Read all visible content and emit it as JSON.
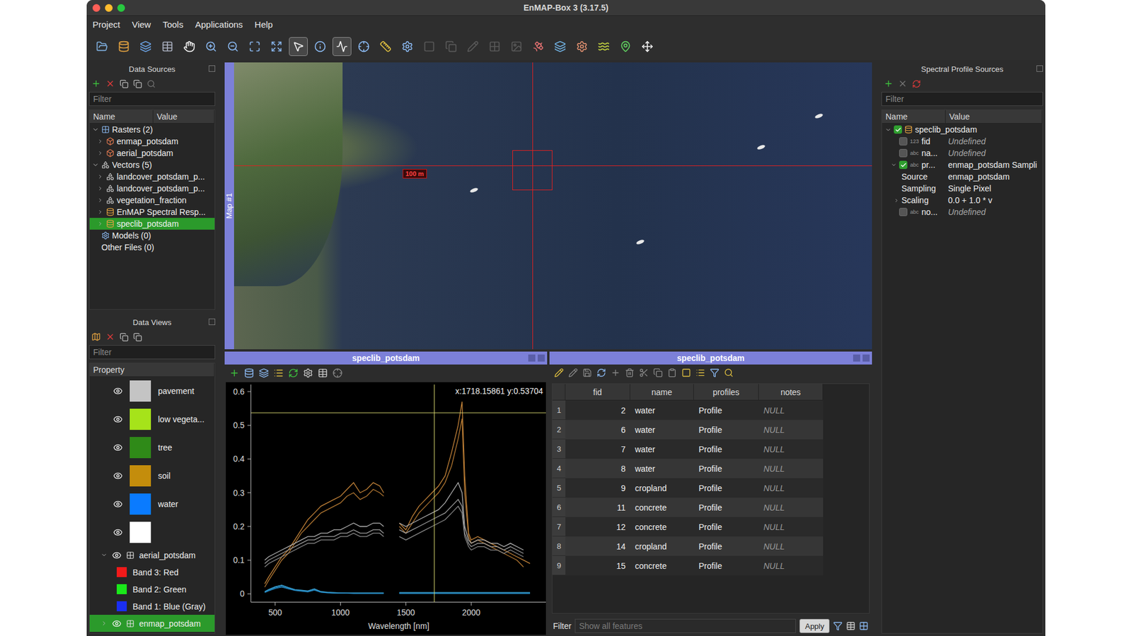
{
  "window": {
    "title": "EnMAP-Box 3 (3.17.5)"
  },
  "menu": [
    "Project",
    "View",
    "Tools",
    "Applications",
    "Help"
  ],
  "toolbar": [
    {
      "selected": false,
      "disabled": false
    },
    {
      "selected": false,
      "disabled": false
    },
    {
      "selected": false,
      "disabled": false
    },
    {
      "selected": false,
      "disabled": false
    },
    {
      "selected": false,
      "disabled": false
    },
    {
      "selected": false,
      "disabled": false
    },
    {
      "selected": false,
      "disabled": false
    },
    {
      "selected": false,
      "disabled": false
    },
    {
      "selected": false,
      "disabled": false
    },
    {
      "selected": true,
      "disabled": false
    },
    {
      "selected": false,
      "disabled": false
    },
    {
      "selected": true,
      "disabled": false
    },
    {
      "selected": false,
      "disabled": false
    },
    {
      "selected": false,
      "disabled": false
    },
    {
      "selected": false,
      "disabled": false
    },
    {
      "selected": false,
      "disabled": true
    },
    {
      "selected": false,
      "disabled": true
    },
    {
      "selected": false,
      "disabled": true
    },
    {
      "selected": false,
      "disabled": true
    },
    {
      "selected": false,
      "disabled": true
    },
    {
      "selected": false,
      "disabled": false
    },
    {
      "selected": false,
      "disabled": false
    },
    {
      "selected": false,
      "disabled": false
    },
    {
      "selected": false,
      "disabled": false
    },
    {
      "selected": false,
      "disabled": false
    },
    {
      "selected": false,
      "disabled": false
    }
  ],
  "data_sources": {
    "title": "Data Sources",
    "filter_placeholder": "Filter",
    "columns": [
      "Name",
      "Value"
    ],
    "groups": [
      {
        "label": "Rasters (2)",
        "kind": "raster",
        "expanded": true,
        "items": [
          {
            "label": "enmap_potsdam",
            "kind": "raster",
            "selected": false
          },
          {
            "label": "aerial_potsdam",
            "kind": "raster",
            "selected": false
          }
        ]
      },
      {
        "label": "Vectors (5)",
        "kind": "vector",
        "expanded": true,
        "items": [
          {
            "label": "landcover_potsdam_p...",
            "kind": "vector",
            "selected": false
          },
          {
            "label": "landcover_potsdam_p...",
            "kind": "vector",
            "selected": false
          },
          {
            "label": "vegetation_fraction",
            "kind": "vector",
            "selected": false
          },
          {
            "label": "EnMAP Spectral Resp...",
            "kind": "library",
            "selected": false
          },
          {
            "label": "speclib_potsdam",
            "kind": "library",
            "selected": true
          }
        ]
      },
      {
        "label": "Models (0)",
        "kind": "model",
        "expanded": false,
        "items": []
      },
      {
        "label": "Other Files (0)",
        "kind": "other",
        "expanded": false,
        "items": []
      }
    ]
  },
  "data_views": {
    "title": "Data Views",
    "filter_placeholder": "Filter",
    "header": "Property",
    "classes": [
      {
        "label": "pavement",
        "color": "#c4c4c4",
        "visible": true
      },
      {
        "label": "low vegeta...",
        "color": "#a6e31a",
        "visible": true
      },
      {
        "label": "tree",
        "color": "#2f8a18",
        "visible": true
      },
      {
        "label": "soil",
        "color": "#c48d0c",
        "visible": true
      },
      {
        "label": "water",
        "color": "#0a7bff",
        "visible": true
      },
      {
        "label": "",
        "color": "#ffffff",
        "visible": true
      }
    ],
    "layers": [
      {
        "label": "aerial_potsdam",
        "visible": true,
        "expanded": true,
        "selected": false,
        "bands": [
          {
            "label": "Band 3: Red",
            "color": "#f21a1a"
          },
          {
            "label": "Band 2: Green",
            "color": "#1ae81a"
          },
          {
            "label": "Band 1: Blue (Gray)",
            "color": "#1a2ef2"
          }
        ]
      },
      {
        "label": "enmap_potsdam",
        "visible": true,
        "expanded": false,
        "selected": true,
        "bands": []
      }
    ]
  },
  "map": {
    "label": "Map #1",
    "scale": "100 m"
  },
  "spectral_view": {
    "title": "speclib_potsdam",
    "readout": "x:1718.15861 y:0.53704",
    "cursor": {
      "x": 1718.15861,
      "y": 0.53704
    },
    "y_ticks": [
      "0",
      "0.1",
      "0.2",
      "0.3",
      "0.4",
      "0.5",
      "0.6"
    ],
    "x_ticks": [
      "500",
      "1000",
      "1500",
      "2000"
    ],
    "x_label": "Wavelength [nm]",
    "wavelengths": [
      420,
      450,
      500,
      550,
      600,
      650,
      700,
      750,
      800,
      850,
      900,
      950,
      1000,
      1050,
      1100,
      1150,
      1200,
      1250,
      1300,
      1330,
      1400,
      1450,
      1500,
      1550,
      1600,
      1650,
      1700,
      1750,
      1800,
      1850,
      1900,
      1930,
      1950,
      1980,
      2000,
      2050,
      2100,
      2150,
      2200,
      2250,
      2300,
      2350,
      2400,
      2450
    ],
    "series": [
      {
        "name": "cropland",
        "color": "#c8863a",
        "values": [
          0.03,
          0.05,
          0.08,
          0.11,
          0.13,
          0.16,
          0.19,
          0.22,
          0.24,
          0.26,
          0.27,
          0.28,
          0.29,
          0.31,
          0.33,
          0.3,
          0.31,
          0.33,
          0.32,
          0.3,
          null,
          0.21,
          0.19,
          0.23,
          0.26,
          0.28,
          0.3,
          0.32,
          0.35,
          0.42,
          0.5,
          0.57,
          0.35,
          0.18,
          0.16,
          0.17,
          0.16,
          0.15,
          0.14,
          0.13,
          0.12,
          0.11,
          0.1,
          0.09
        ]
      },
      {
        "name": "cropland",
        "color": "#b67a33",
        "values": [
          0.02,
          0.04,
          0.07,
          0.1,
          0.12,
          0.15,
          0.18,
          0.2,
          0.22,
          0.24,
          0.25,
          0.26,
          0.27,
          0.29,
          0.3,
          0.28,
          0.29,
          0.31,
          0.3,
          0.29,
          null,
          0.2,
          0.18,
          0.21,
          0.24,
          0.26,
          0.28,
          0.3,
          0.33,
          0.38,
          0.46,
          0.52,
          0.3,
          0.17,
          0.15,
          0.16,
          0.15,
          0.14,
          0.13,
          0.12,
          0.11,
          0.1,
          0.08
        ]
      },
      {
        "name": "concrete",
        "color": "#b4b4b4",
        "values": [
          0.1,
          0.11,
          0.12,
          0.13,
          0.14,
          0.15,
          0.16,
          0.17,
          0.17,
          0.18,
          0.18,
          0.19,
          0.19,
          0.2,
          0.21,
          0.2,
          0.2,
          0.21,
          0.21,
          0.2,
          null,
          0.21,
          0.2,
          0.21,
          0.22,
          0.23,
          0.24,
          0.25,
          0.27,
          0.3,
          0.33,
          0.3,
          0.2,
          0.16,
          0.15,
          0.16,
          0.16,
          0.15,
          0.15,
          0.14,
          0.15,
          0.14,
          0.13
        ]
      },
      {
        "name": "concrete",
        "color": "#a0a0a0",
        "values": [
          0.09,
          0.1,
          0.11,
          0.12,
          0.13,
          0.14,
          0.15,
          0.16,
          0.16,
          0.17,
          0.17,
          0.17,
          0.18,
          0.18,
          0.19,
          0.18,
          0.18,
          0.19,
          0.19,
          0.18,
          null,
          0.19,
          0.18,
          0.19,
          0.2,
          0.21,
          0.22,
          0.23,
          0.24,
          0.26,
          0.28,
          0.26,
          0.18,
          0.15,
          0.14,
          0.15,
          0.15,
          0.14,
          0.14,
          0.13,
          0.14,
          0.13,
          0.12
        ]
      },
      {
        "name": "concrete",
        "color": "#8c8c8c",
        "values": [
          0.08,
          0.09,
          0.1,
          0.11,
          0.12,
          0.13,
          0.14,
          0.15,
          0.15,
          0.16,
          0.16,
          0.16,
          0.17,
          0.17,
          0.18,
          0.17,
          0.17,
          0.18,
          0.18,
          0.17,
          null,
          0.17,
          0.16,
          0.17,
          0.18,
          0.19,
          0.2,
          0.21,
          0.22,
          0.24,
          0.26,
          0.24,
          0.17,
          0.14,
          0.13,
          0.14,
          0.14,
          0.13,
          0.13,
          0.12,
          0.13,
          0.12,
          0.11
        ]
      },
      {
        "name": "water",
        "color": "#2a8fc8",
        "values": [
          0.006,
          0.012,
          0.02,
          0.025,
          0.018,
          0.012,
          0.01,
          0.008,
          0.014,
          0.006,
          0.004,
          0.003,
          0.003,
          0.002,
          0.002,
          0.002,
          0.002,
          0.002,
          0.002,
          0.002,
          null,
          0.002,
          0.002,
          0.002,
          0.002,
          0.002,
          0.002,
          0.002,
          0.002,
          0.002,
          0.002,
          0.002,
          0.002,
          0.002,
          0.002,
          0.002,
          0.002,
          0.002,
          0.002,
          0.002,
          0.002,
          0.002,
          0.002,
          0.002
        ]
      },
      {
        "name": "water",
        "color": "#1f7fb8",
        "values": [
          0.005,
          0.01,
          0.018,
          0.022,
          0.016,
          0.011,
          0.009,
          0.007,
          0.012,
          0.005,
          0.004,
          0.003,
          0.003,
          0.002,
          0.002,
          0.002,
          0.002,
          0.002,
          0.002,
          0.002,
          null,
          0.003,
          0.003,
          0.003,
          0.003,
          0.003,
          0.003,
          0.003,
          0.003,
          0.003,
          0.003,
          0.003,
          0.003,
          0.003,
          0.003,
          0.003,
          0.003,
          0.003,
          0.003,
          0.003,
          0.003,
          0.003,
          0.003,
          0.003
        ]
      },
      {
        "name": "water",
        "color": "#3aa0d0",
        "values": [
          0.007,
          0.013,
          0.021,
          0.026,
          0.019,
          0.013,
          0.011,
          0.009,
          0.015,
          0.007,
          0.005,
          0.004,
          0.003,
          0.003,
          0.003,
          0.003,
          0.003,
          0.003,
          0.003,
          0.003,
          null,
          0.004,
          0.004,
          0.004,
          0.004,
          0.004,
          0.004,
          0.004,
          0.004,
          0.004,
          0.004,
          0.004,
          0.004,
          0.004,
          0.004,
          0.004,
          0.004,
          0.004,
          0.004,
          0.004,
          0.004,
          0.004,
          0.004,
          0.004
        ]
      },
      {
        "name": "water",
        "color": "#2487c0",
        "values": [
          0.004,
          0.009,
          0.016,
          0.02,
          0.015,
          0.01,
          0.008,
          0.006,
          0.011,
          0.005,
          0.003,
          0.002,
          0.002,
          0.002,
          0.001,
          0.001,
          0.001,
          0.001,
          0.001,
          0.001,
          null,
          0.001,
          0.001,
          0.001,
          0.001,
          0.001,
          0.001,
          0.001,
          0.001,
          0.001,
          0.001,
          0.001,
          0.001,
          0.001,
          0.001,
          0.001,
          0.001,
          0.001,
          0.001,
          0.001,
          0.001,
          0.001,
          0.001,
          0.001
        ]
      }
    ]
  },
  "table": {
    "title": "speclib_potsdam",
    "columns": [
      "fid",
      "name",
      "profiles",
      "notes"
    ],
    "rows": [
      {
        "n": "1",
        "fid": "2",
        "name": "water",
        "profiles": "Profile",
        "notes": "NULL",
        "selected": false
      },
      {
        "n": "2",
        "fid": "6",
        "name": "water",
        "profiles": "Profile",
        "notes": "NULL",
        "selected": false
      },
      {
        "n": "3",
        "fid": "7",
        "name": "water",
        "profiles": "Profile",
        "notes": "NULL",
        "selected": false
      },
      {
        "n": "4",
        "fid": "8",
        "name": "water",
        "profiles": "Profile",
        "notes": "NULL",
        "selected": false
      },
      {
        "n": "5",
        "fid": "9",
        "name": "cropland",
        "profiles": "Profile",
        "notes": "NULL",
        "selected": false
      },
      {
        "n": "6",
        "fid": "11",
        "name": "concrete",
        "profiles": "Profile",
        "notes": "NULL",
        "selected": false
      },
      {
        "n": "7",
        "fid": "12",
        "name": "concrete",
        "profiles": "Profile",
        "notes": "NULL",
        "selected": false
      },
      {
        "n": "8",
        "fid": "14",
        "name": "cropland",
        "profiles": "Profile",
        "notes": "NULL",
        "selected": false
      },
      {
        "n": "9",
        "fid": "15",
        "name": "concrete",
        "profiles": "Profile",
        "notes": "NULL",
        "selected": false
      }
    ],
    "filter_label": "Filter",
    "filter_placeholder": "Show all features",
    "apply": "Apply"
  },
  "profile_sources": {
    "title": "Spectral Profile Sources",
    "filter_placeholder": "Filter",
    "columns": [
      "Name",
      "Value"
    ],
    "root": {
      "label": "speclib_potsdam",
      "checked": true,
      "expanded": true
    },
    "fields": [
      {
        "type": "123",
        "name": "fid",
        "value": "Undefined",
        "checked": false,
        "expanded": false,
        "props": []
      },
      {
        "type": "abc",
        "name": "na...",
        "value": "Undefined",
        "checked": false,
        "expanded": false,
        "props": []
      },
      {
        "type": "abc",
        "name": "pr...",
        "value": "enmap_potsdam Sampli",
        "checked": true,
        "expanded": true,
        "props": [
          {
            "name": "Source",
            "value": "enmap_potsdam",
            "expandable": false
          },
          {
            "name": "Sampling",
            "value": "Single Pixel",
            "expandable": false
          },
          {
            "name": "Scaling",
            "value": "0.0 + 1.0 * v",
            "expandable": true
          }
        ]
      },
      {
        "type": "abc",
        "name": "no...",
        "value": "Undefined",
        "checked": false,
        "expanded": false,
        "props": []
      }
    ]
  }
}
